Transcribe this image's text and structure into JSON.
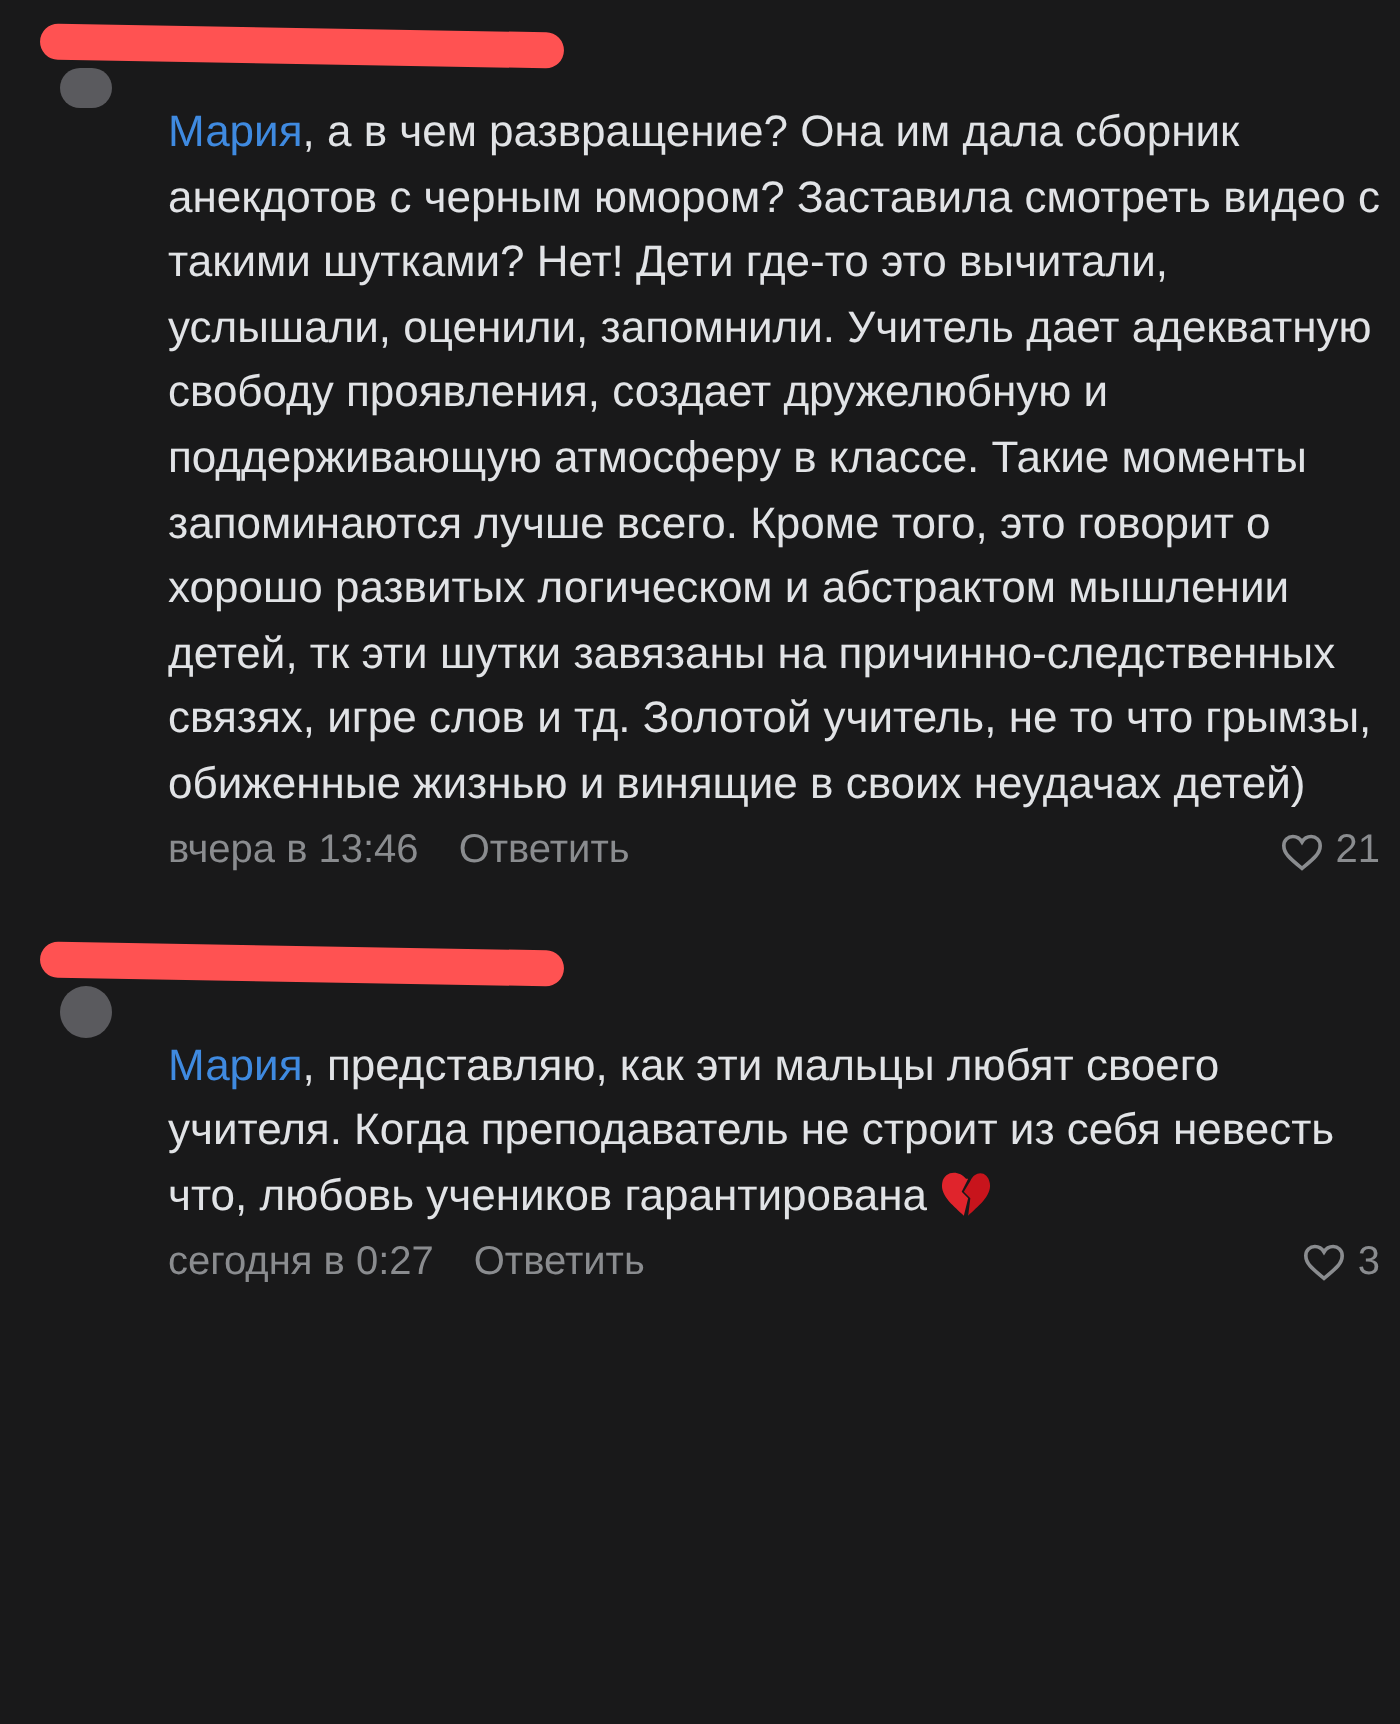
{
  "comments": [
    {
      "mention": "Мария",
      "text": ", а в чем развращение? Она им дала сборник анекдотов с черным юмором? Заставила смотреть видео с такими шутками? Нет! Дети где-то это вычитали, услышали, оценили, запомнили. Учитель дает адекватную свободу проявления, создает дружелюбную и поддерживающую атмосферу в классе. Такие моменты запоминаются лучше всего. Кроме того, это говорит о хорошо развитых логическом и абстрактом мышлении детей, тк эти шутки завязаны на причинно-следственных связях, игре слов и тд. Золотой учитель, не то что грымзы, обиженные жизнью и винящие в своих неудачах детей)",
      "emoji": false,
      "time": "вчера в 13:46",
      "reply": "Ответить",
      "likes": "21"
    },
    {
      "mention": "Мария",
      "text": ", представляю, как эти мальцы любят своего учителя. Когда преподаватель не строит из себя невесть что, любовь учеников гарантирована",
      "emoji": true,
      "time": "сегодня в 0:27",
      "reply": "Ответить",
      "likes": "3"
    }
  ]
}
